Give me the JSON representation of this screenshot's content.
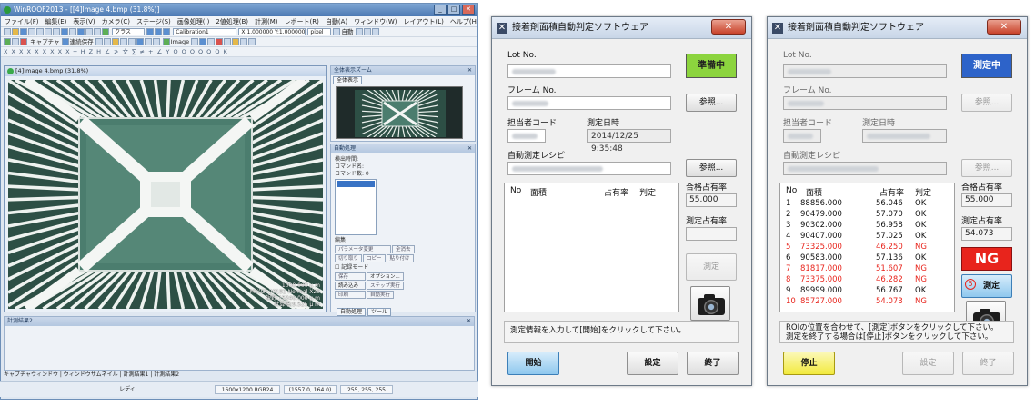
{
  "winroof": {
    "title": "WinROOF2013 - [[4]Image 4.bmp (31.8%)]",
    "window_buttons": [
      "_",
      "□",
      "✕"
    ],
    "menu": [
      "ファイル(F)",
      "編集(E)",
      "表示(V)",
      "カメラ(C)",
      "ステージ(S)",
      "画像処理(I)",
      "2値処理(B)",
      "計測(M)",
      "レポート(R)",
      "自動(A)",
      "ウィンドウ(W)",
      "レイアウト(L)",
      "ヘルプ(H)"
    ],
    "toolbar": {
      "combo_mode": "クラス",
      "calibration": "Calibration1",
      "scale_text": "X:1.000000 Y:1.000000",
      "unit": "pixel",
      "auto": "自動",
      "capture": "キャプチャ",
      "continuous": "連続保存",
      "image_label": "Image",
      "shape_row": "X X X X X X X X X ─ H Z H ∠ ≯ 文 ∑ ≠ + ∠ Y O O O Q Q Q K"
    },
    "image_panel": {
      "title": "[4]Image 4.bmp (31.8%)",
      "scale_text": "1000.000 μ m",
      "info_lines": [
        "MX(G)-20192 Normal X20",
        "視野:15240.000 μ m",
        "計算幅:9.525 μ m"
      ]
    },
    "overview_panel": {
      "title": "全体表示ズーム",
      "tab": "全体表示"
    },
    "auto_panel": {
      "title": "自動処理",
      "fields": [
        "検出時間:",
        "コマンド名:",
        "コマンド数:  0"
      ],
      "edit_label": "編集",
      "buttons_row1": [
        "パラメータ変更",
        "全消去"
      ],
      "buttons_row2": [
        "切り取り",
        "コピー",
        "貼り付け"
      ],
      "record_mode": "記録モード",
      "record_buttons": [
        "保存",
        "オプション..."
      ],
      "read_buttons": [
        "読み込み",
        "ステップ実行"
      ],
      "run_buttons": [
        "印刷",
        "自動実行"
      ],
      "tabs": [
        "自動処理",
        "ツール"
      ]
    },
    "result_panel": {
      "title": "計測結果2"
    },
    "bottom_tabs": [
      "キャプチャウィンドウ",
      "ウィンドウサムネイル",
      "計測結果1",
      "計測結果2"
    ],
    "status": {
      "mode": "レディ",
      "resolution": "1600x1200 RGB24",
      "coord": "(1557.0, 164.0)",
      "rgb": "255, 255, 255"
    }
  },
  "window_ready": {
    "title": "接着剤面積自動判定ソフトウェア",
    "close": "✕",
    "lot_label": "Lot No.",
    "status": "準備中",
    "status_color": "#8cd43e",
    "frame_label": "フレーム No.",
    "browse1": "参照...",
    "operator_label": "担当者コード",
    "datetime_label": "測定日時",
    "datetime_value": "2014/12/25 9:35:48",
    "recipe_label": "自動測定レシピ",
    "browse2": "参照...",
    "grid_headers": [
      "No",
      "面積",
      "占有率",
      "判定"
    ],
    "pass_label": "合格占有率",
    "pass_value": "55.000",
    "measured_label": "測定占有率",
    "measured_value": "",
    "measure_button": "測定",
    "message": "測定情報を入力して[開始]をクリックして下さい。",
    "start_button": "開始",
    "settings_button": "設定",
    "exit_button": "終了"
  },
  "window_result": {
    "title": "接着剤面積自動判定ソフトウェア",
    "close": "✕",
    "lot_label": "Lot No.",
    "status": "測定中",
    "status_color": "#2d63c9",
    "frame_label": "フレーム No.",
    "browse1": "参照...",
    "operator_label": "担当者コード",
    "datetime_label": "測定日時",
    "recipe_label": "自動測定レシピ",
    "browse2": "参照...",
    "grid_headers": [
      "No",
      "面積",
      "占有率",
      "判定"
    ],
    "rows": [
      {
        "no": "1",
        "area": "88856.000",
        "ratio": "56.046",
        "judge": "OK",
        "ng": false
      },
      {
        "no": "2",
        "area": "90479.000",
        "ratio": "57.070",
        "judge": "OK",
        "ng": false
      },
      {
        "no": "3",
        "area": "90302.000",
        "ratio": "56.958",
        "judge": "OK",
        "ng": false
      },
      {
        "no": "4",
        "area": "90407.000",
        "ratio": "57.025",
        "judge": "OK",
        "ng": false
      },
      {
        "no": "5",
        "area": "73325.000",
        "ratio": "46.250",
        "judge": "NG",
        "ng": true
      },
      {
        "no": "6",
        "area": "90583.000",
        "ratio": "57.136",
        "judge": "OK",
        "ng": false
      },
      {
        "no": "7",
        "area": "81817.000",
        "ratio": "51.607",
        "judge": "NG",
        "ng": true
      },
      {
        "no": "8",
        "area": "73375.000",
        "ratio": "46.282",
        "judge": "NG",
        "ng": true
      },
      {
        "no": "9",
        "area": "89999.000",
        "ratio": "56.767",
        "judge": "OK",
        "ng": false
      },
      {
        "no": "10",
        "area": "85727.000",
        "ratio": "54.073",
        "judge": "NG",
        "ng": true
      }
    ],
    "pass_label": "合格占有率",
    "pass_value": "55.000",
    "measured_label": "測定占有率",
    "measured_value": "54.073",
    "judgment": "NG",
    "judgment_color": "#e8241c",
    "badge_number": "5",
    "measure_button": "測定",
    "message_lines": [
      "ROIの位置を合わせて、[測定]ボタンをクリックして下さい。",
      "測定を終了する場合は[停止]ボタンをクリックして下さい。"
    ],
    "stop_button": "停止",
    "settings_button": "設定",
    "exit_button": "終了"
  }
}
